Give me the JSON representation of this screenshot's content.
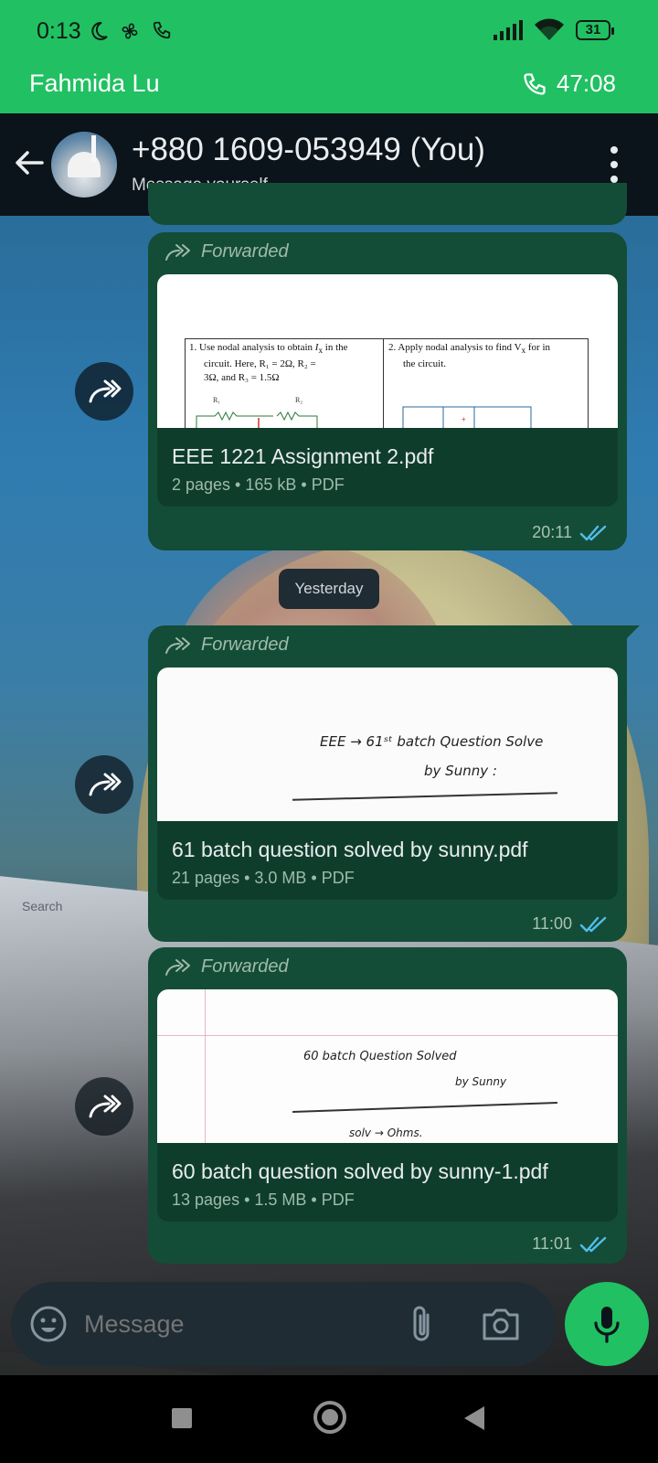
{
  "status_bar": {
    "time": "0:13",
    "battery": "31"
  },
  "call_bar": {
    "name": "Fahmida Lu",
    "timer": "47:08"
  },
  "header": {
    "title": "+880 1609-053949 (You)",
    "subtitle": "Message yourself"
  },
  "messages": [
    {
      "forwarded_label": "Forwarded",
      "file_name": "EEE 1221 Assignment 2.pdf",
      "meta": "2 pages • 165 kB • PDF",
      "time": "20:11",
      "preview": {
        "q1": "1.  Use nodal analysis to obtain",
        "q1_var": "I",
        "q1_sub": "x",
        "q1_end": " in the",
        "q1_line2": "circuit.      Here,      R₁ = 2Ω, R₂ =",
        "q1_line3": "3Ω, and R₃ = 1.5Ω",
        "q2": "2.  Apply nodal analysis to find V",
        "q2_sub": "x",
        "q2_end": "  for in",
        "q2_line2": "the circuit.",
        "r1": "R₁",
        "r2": "R₂"
      }
    },
    {
      "forwarded_label": "Forwarded",
      "file_name": "61 batch question solved by sunny.pdf",
      "meta": "21 pages • 3.0 MB • PDF",
      "time": "11:00",
      "preview": {
        "line1": "EEE → 61ˢᵗ batch  Question Solve",
        "line2": "by   Sunny :"
      }
    },
    {
      "forwarded_label": "Forwarded",
      "file_name": "60 batch question solved by sunny-1.pdf",
      "meta": "13 pages • 1.5 MB • PDF",
      "time": "11:01",
      "preview": {
        "line1": "60  batch    Question    Solved",
        "line2": "by   Sunny",
        "line3": "solv        →        Ohms."
      }
    }
  ],
  "date_chip": "Yesterday",
  "wallpaper_search": "Search",
  "composer": {
    "placeholder": "Message"
  },
  "colors": {
    "accent": "#21c063",
    "bubble": "#144d37",
    "header": "#0b141a",
    "read_ticks": "#53bdeb"
  }
}
